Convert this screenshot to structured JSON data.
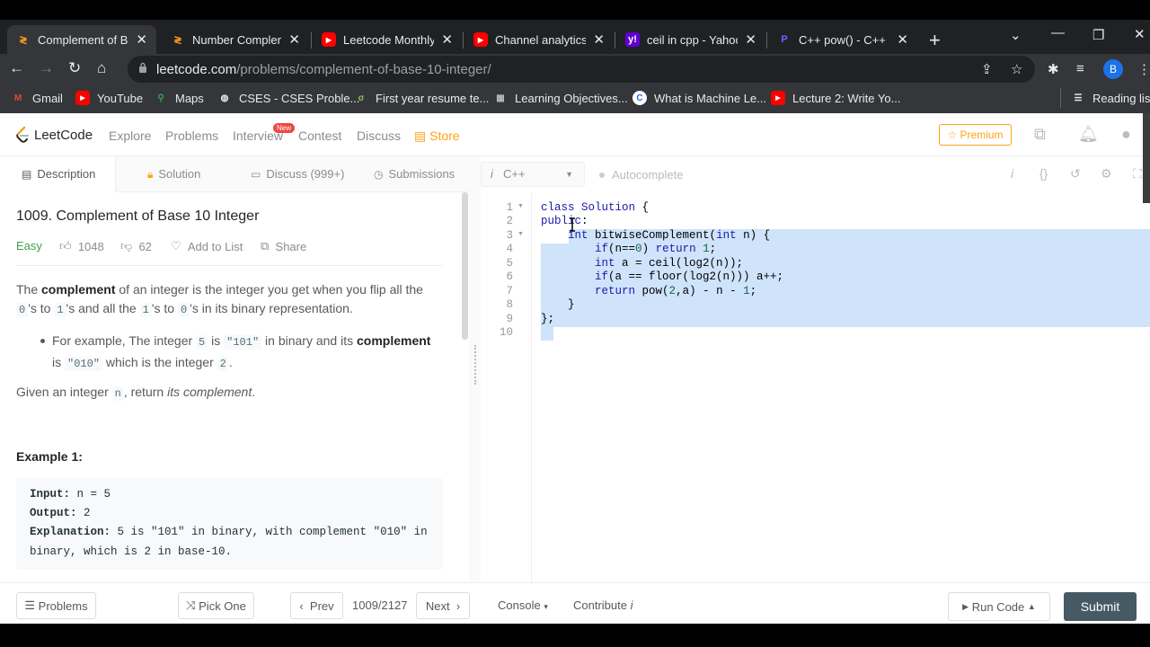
{
  "browser": {
    "tabs": [
      {
        "title": "Complement of Bas",
        "favicon": "leetcode-icon",
        "active": true
      },
      {
        "title": "Number Compleme",
        "favicon": "leetcode-icon",
        "active": false
      },
      {
        "title": "Leetcode Monthly (",
        "favicon": "youtube-icon",
        "active": false
      },
      {
        "title": "Channel analytics -",
        "favicon": "youtube-icon",
        "active": false
      },
      {
        "title": "ceil in cpp - Yahoo",
        "favicon": "yahoo-icon",
        "active": false
      },
      {
        "title": "C++ pow() - C++ S",
        "favicon": "programiz-icon",
        "active": false
      }
    ],
    "url_domain": "leetcode.com",
    "url_path": "/problems/complement-of-base-10-integer/",
    "profile_initial": "B",
    "bookmarks": [
      {
        "label": "Gmail",
        "icon": "gmail-icon"
      },
      {
        "label": "YouTube",
        "icon": "youtube-icon"
      },
      {
        "label": "Maps",
        "icon": "maps-icon"
      },
      {
        "label": "CSES - CSES Proble...",
        "icon": "cses-icon"
      },
      {
        "label": "First year resume te...",
        "icon": "resume-icon"
      },
      {
        "label": "Learning Objectives...",
        "icon": "learning-icon"
      },
      {
        "label": "What is Machine Le...",
        "icon": "c-icon"
      },
      {
        "label": "Lecture 2: Write Yo...",
        "icon": "youtube-icon"
      }
    ],
    "reading_list": "Reading list"
  },
  "nav": {
    "brand": "LeetCode",
    "links": [
      "Explore",
      "Problems",
      "Interview",
      "Contest",
      "Discuss"
    ],
    "new_badge": "New",
    "store": "Store",
    "premium": "Premium"
  },
  "left_tabs": [
    "Description",
    "Solution",
    "Discuss (999+)",
    "Submissions"
  ],
  "problem": {
    "title": "1009. Complement of Base 10 Integer",
    "difficulty": "Easy",
    "likes": "1048",
    "dislikes": "62",
    "add_to_list": "Add to List",
    "share": "Share",
    "p1_a": "The ",
    "p1_b": "complement",
    "p1_c": " of an integer is the integer you get when you flip all the",
    "p1_d0": "0",
    "p1_e": "'s to ",
    "p1_d1": "1",
    "p1_f": "'s and all the ",
    "p1_d2": "1",
    "p1_g": "'s to ",
    "p1_d3": "0",
    "p1_h": "'s in its binary representation.",
    "b1_a": "For example, The integer ",
    "b1_5": "5",
    "b1_b": " is ",
    "b1_101": "\"101\"",
    "b1_c": " in binary and its ",
    "b1_comp": "complement",
    "b1_d": "is ",
    "b1_010": "\"010\"",
    "b1_e": " which is the integer ",
    "b1_2": "2",
    "b1_f": ".",
    "p2_a": "Given an integer ",
    "p2_n": "n",
    "p2_b": ", return ",
    "p2_c": "its complement",
    "p2_d": ".",
    "example_title": "Example 1:",
    "ex_input_label": "Input:",
    "ex_input": " n = 5",
    "ex_output_label": "Output:",
    "ex_output": " 2",
    "ex_expl_label": "Explanation:",
    "ex_expl_1": " 5 is \"101\" in binary, with complement \"010\" in",
    "ex_expl_2": "binary, which is 2 in base-10."
  },
  "editor": {
    "language": "C++",
    "language_icon": "i",
    "autocomplete": "Autocomplete",
    "lines": [
      "class Solution {",
      "public:",
      "    int bitwiseComplement(int n) {",
      "        if(n==0) return 1;",
      "        int a = ceil(log2(n));",
      "        if(a == floor(log2(n))) a++;",
      "        return pow(2,a) - n - 1;",
      "    }",
      "};",
      ""
    ],
    "line_numbers": [
      "1",
      "2",
      "3",
      "4",
      "5",
      "6",
      "7",
      "8",
      "9",
      "10"
    ]
  },
  "bottom": {
    "problems": "Problems",
    "pick_one": "Pick One",
    "prev": "Prev",
    "counter": "1009/2127",
    "next": "Next",
    "console": "Console",
    "contribute": "Contribute",
    "run_code": "Run Code",
    "submit": "Submit"
  }
}
